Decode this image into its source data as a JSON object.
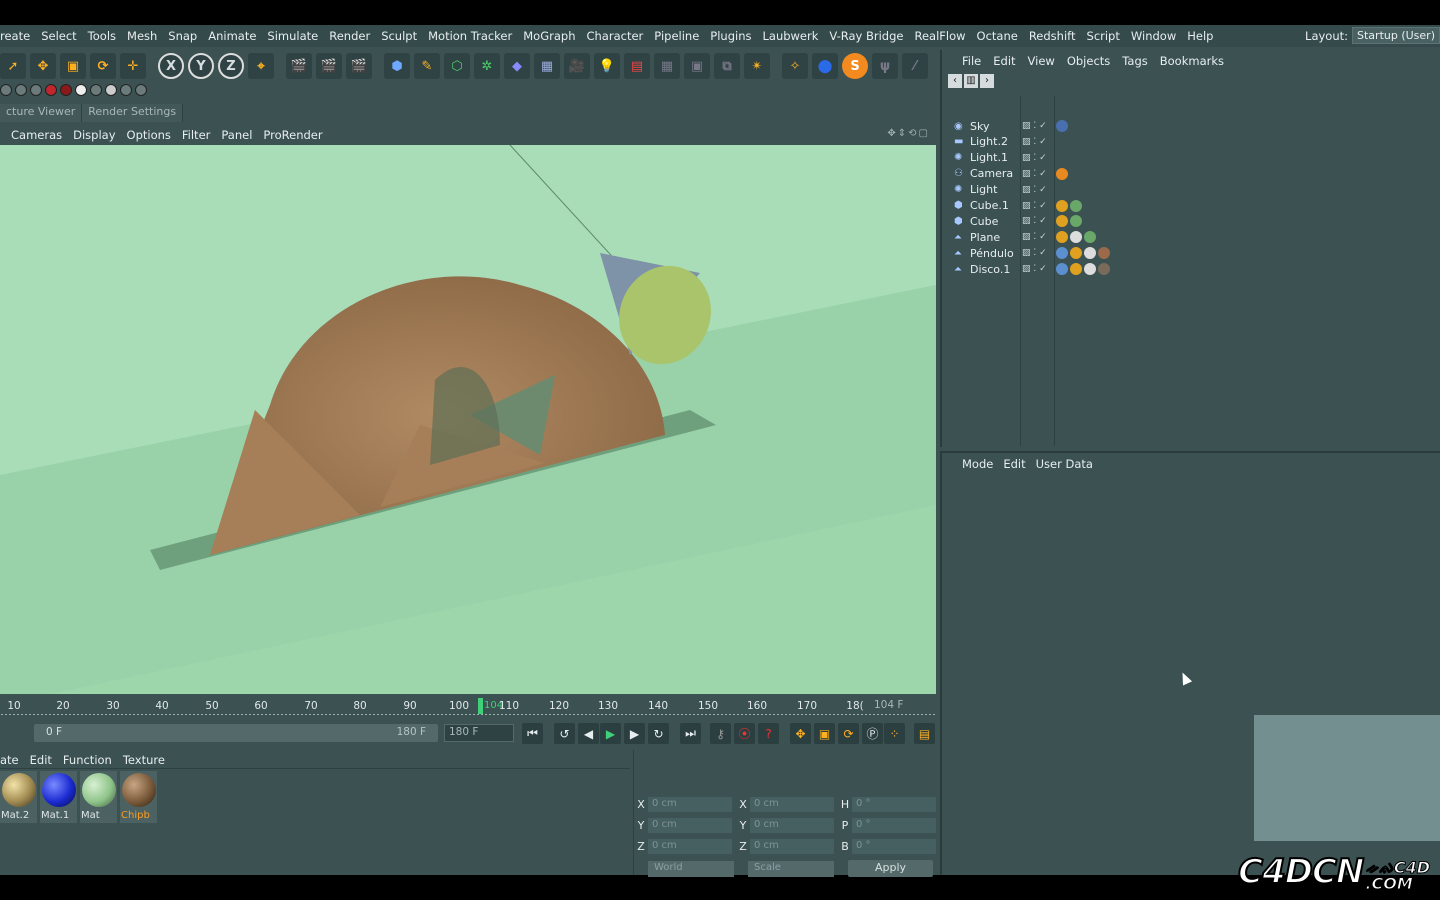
{
  "menu": [
    "reate",
    "Select",
    "Tools",
    "Mesh",
    "Snap",
    "Animate",
    "Simulate",
    "Render",
    "Sculpt",
    "Motion Tracker",
    "MoGraph",
    "Character",
    "Pipeline",
    "Plugins",
    "Laubwerk",
    "V-Ray Bridge",
    "RealFlow",
    "Octane",
    "Redshift",
    "Script",
    "Window",
    "Help"
  ],
  "layout": {
    "label": "Layout:",
    "value": "Startup (User)"
  },
  "toolbar_axes": [
    "X",
    "Y",
    "Z"
  ],
  "viewer_tabs": [
    "cture Viewer",
    "Render Settings"
  ],
  "viewport_menu": [
    "Cameras",
    "Display",
    "Options",
    "Filter",
    "Panel",
    "ProRender"
  ],
  "timeline": {
    "ticks": [
      "10",
      "20",
      "30",
      "40",
      "50",
      "60",
      "70",
      "80",
      "90",
      "100",
      "110",
      "120",
      "130",
      "140",
      "150",
      "160",
      "170",
      "18("
    ],
    "current_label": "104",
    "current_frame": "104 F",
    "start": "0 F",
    "end_in_slider": "180 F",
    "end_field": "180 F"
  },
  "material_menu": [
    "ate",
    "Edit",
    "Function",
    "Texture"
  ],
  "materials": [
    {
      "name": "Mat.2",
      "color": "#a08a50"
    },
    {
      "name": "Mat.1",
      "color": "#1a2ad0"
    },
    {
      "name": "Mat",
      "color": "#8fc48a"
    },
    {
      "name": "Chipb",
      "color": "#7a5a3a"
    }
  ],
  "coords": {
    "rows": [
      {
        "a1": "X",
        "v1": "0 cm",
        "a2": "X",
        "v2": "0 cm",
        "a3": "H",
        "v3": "0 °"
      },
      {
        "a1": "Y",
        "v1": "0 cm",
        "a2": "Y",
        "v2": "0 cm",
        "a3": "P",
        "v3": "0 °"
      },
      {
        "a1": "Z",
        "v1": "0 cm",
        "a2": "Z",
        "v2": "0 cm",
        "a3": "B",
        "v3": "0 °"
      }
    ],
    "mode1": "World",
    "mode2": "Scale",
    "apply": "Apply"
  },
  "object_manager": {
    "menu": [
      "File",
      "Edit",
      "View",
      "Objects",
      "Tags",
      "Bookmarks"
    ],
    "objects": [
      {
        "name": "Sky",
        "icon": "sky-icon",
        "tags": [
          "#4a6fb0"
        ]
      },
      {
        "name": "Light.2",
        "icon": "area-light-icon",
        "tags": []
      },
      {
        "name": "Light.1",
        "icon": "light-icon",
        "tags": []
      },
      {
        "name": "Camera",
        "icon": "camera-icon",
        "tags": [
          "#e88a20"
        ]
      },
      {
        "name": "Light",
        "icon": "light-icon",
        "tags": []
      },
      {
        "name": "Cube.1",
        "icon": "cube-icon",
        "tags": [
          "#e0a020",
          "#6aa86a"
        ]
      },
      {
        "name": "Cube",
        "icon": "cube-icon",
        "tags": [
          "#e0a020",
          "#6aa86a"
        ]
      },
      {
        "name": "Plane",
        "icon": "plane-icon",
        "tags": [
          "#e0a020",
          "#dddddd",
          "#6aa86a"
        ]
      },
      {
        "name": "Péndulo",
        "icon": "pendulum-icon",
        "tags": [
          "#5b8fd0",
          "#e0a020",
          "#dddddd",
          "#9a6a4a"
        ]
      },
      {
        "name": "Disco.1",
        "icon": "disc-icon",
        "tags": [
          "#5b8fd0",
          "#e0a020",
          "#dddddd",
          "#7a6a5a"
        ]
      }
    ]
  },
  "attribute_manager": {
    "menu": [
      "Mode",
      "Edit",
      "User Data"
    ]
  },
  "watermark": {
    "main": "C4DCN",
    "sub_top": "ᨀᨁC4D",
    "sub_bottom": ".COM"
  }
}
